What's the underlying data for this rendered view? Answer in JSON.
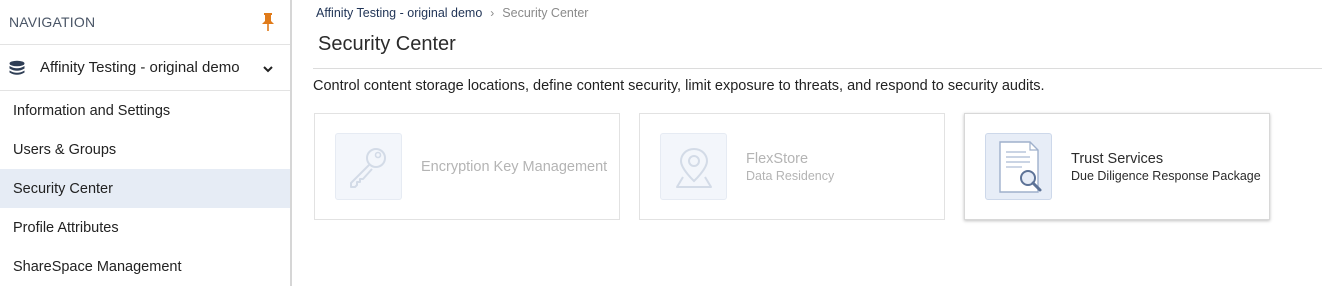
{
  "sidebar": {
    "header": "NAVIGATION",
    "org_name": "Affinity Testing - original demo",
    "items": [
      {
        "label": "Information and Settings"
      },
      {
        "label": "Users & Groups"
      },
      {
        "label": "Security Center",
        "active": true
      },
      {
        "label": "Profile Attributes"
      },
      {
        "label": "ShareSpace Management"
      }
    ],
    "pin_color": "#e07b1a"
  },
  "breadcrumb": {
    "root": "Affinity Testing - original demo",
    "separator": "›",
    "current": "Security Center"
  },
  "page": {
    "title": "Security Center",
    "description": "Control content storage locations, define content security, limit exposure to threats, and respond to security audits."
  },
  "cards": [
    {
      "title": "Encryption Key Management",
      "subtitle": "",
      "icon": "key-icon",
      "enabled": false
    },
    {
      "title": "FlexStore",
      "subtitle": "Data Residency",
      "icon": "map-pin-icon",
      "enabled": false
    },
    {
      "title": "Trust Services",
      "subtitle": "Due Diligence Response Package",
      "icon": "document-search-icon",
      "enabled": true
    }
  ],
  "colors": {
    "active_nav_bg": "#e6ecf5",
    "accent_pin": "#e07b1a",
    "disabled_text": "#b4b4b4"
  }
}
